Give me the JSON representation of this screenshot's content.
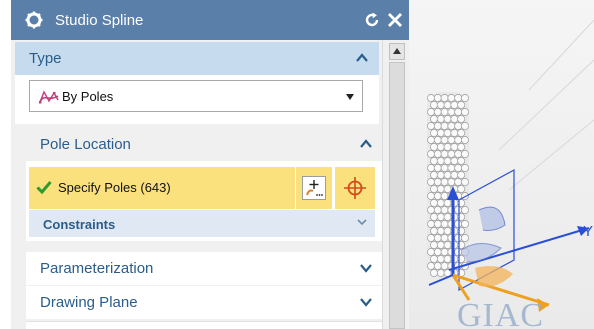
{
  "dialog": {
    "title": "Studio Spline",
    "icons": {
      "settings": "gear-icon",
      "reset": "reset-icon",
      "close": "close-icon"
    }
  },
  "sections": {
    "type": {
      "label": "Type",
      "select_value": "By Poles",
      "select_icon": "spline-poles-icon"
    },
    "pole_location": {
      "label": "Pole Location",
      "specify_label": "Specify Poles (643)",
      "constraints_label": "Constraints"
    },
    "parameterization": {
      "label": "Parameterization"
    },
    "drawing_plane": {
      "label": "Drawing Plane"
    }
  },
  "viewport": {
    "axis_label": "Y",
    "watermark": "GIAC"
  },
  "colors": {
    "titlebar": "#5a7fa8",
    "section_header_active": "#c6dcee",
    "selection_yellow": "#fbe17e",
    "label_blue": "#2a5d8c",
    "check_green": "#2e9a2e",
    "crosshair_red": "#d04a1a"
  }
}
